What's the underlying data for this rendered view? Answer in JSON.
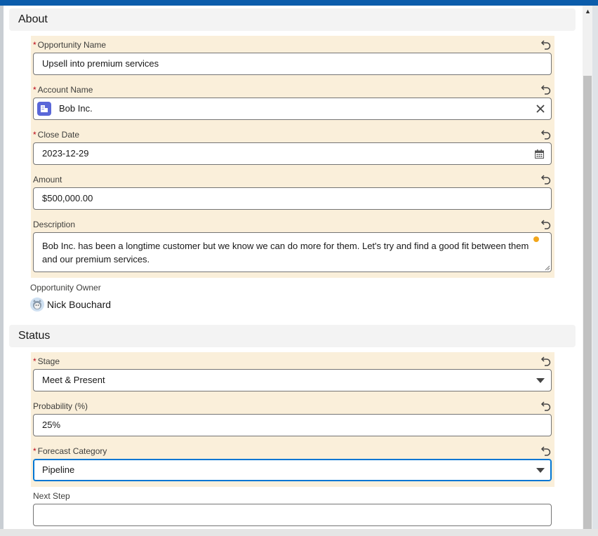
{
  "about": {
    "section_title": "About",
    "opportunity_name": {
      "label": "Opportunity Name",
      "required": "*",
      "value": "Upsell into premium services"
    },
    "account_name": {
      "label": "Account Name",
      "required": "*",
      "value": "Bob Inc."
    },
    "close_date": {
      "label": "Close Date",
      "required": "*",
      "value": "2023-12-29"
    },
    "amount": {
      "label": "Amount",
      "value": "$500,000.00"
    },
    "description": {
      "label": "Description",
      "value": "Bob Inc. has been a longtime customer but we know we can do more for them. Let's try and find a good fit between them and our premium services."
    },
    "owner": {
      "label": "Opportunity Owner",
      "name": "Nick Bouchard"
    }
  },
  "status": {
    "section_title": "Status",
    "stage": {
      "label": "Stage",
      "required": "*",
      "value": "Meet & Present"
    },
    "probability": {
      "label": "Probability (%)",
      "value": "25%"
    },
    "forecast_category": {
      "label": "Forecast Category",
      "required": "*",
      "value": "Pipeline"
    },
    "next_step": {
      "label": "Next Step",
      "value": ""
    }
  },
  "icons": {
    "undo": "undo-icon",
    "account": "account-icon",
    "clear": "close-icon",
    "calendar": "calendar-icon",
    "dropdown": "chevron-down-icon",
    "avatar": "avatar"
  },
  "colors": {
    "header_bar": "#0b5cab",
    "edited_field_bg": "#faefda",
    "focus_border": "#0176d3",
    "required": "#ba0517",
    "unsaved_dot": "#f2a61b",
    "account_icon": "#5a67d8"
  }
}
